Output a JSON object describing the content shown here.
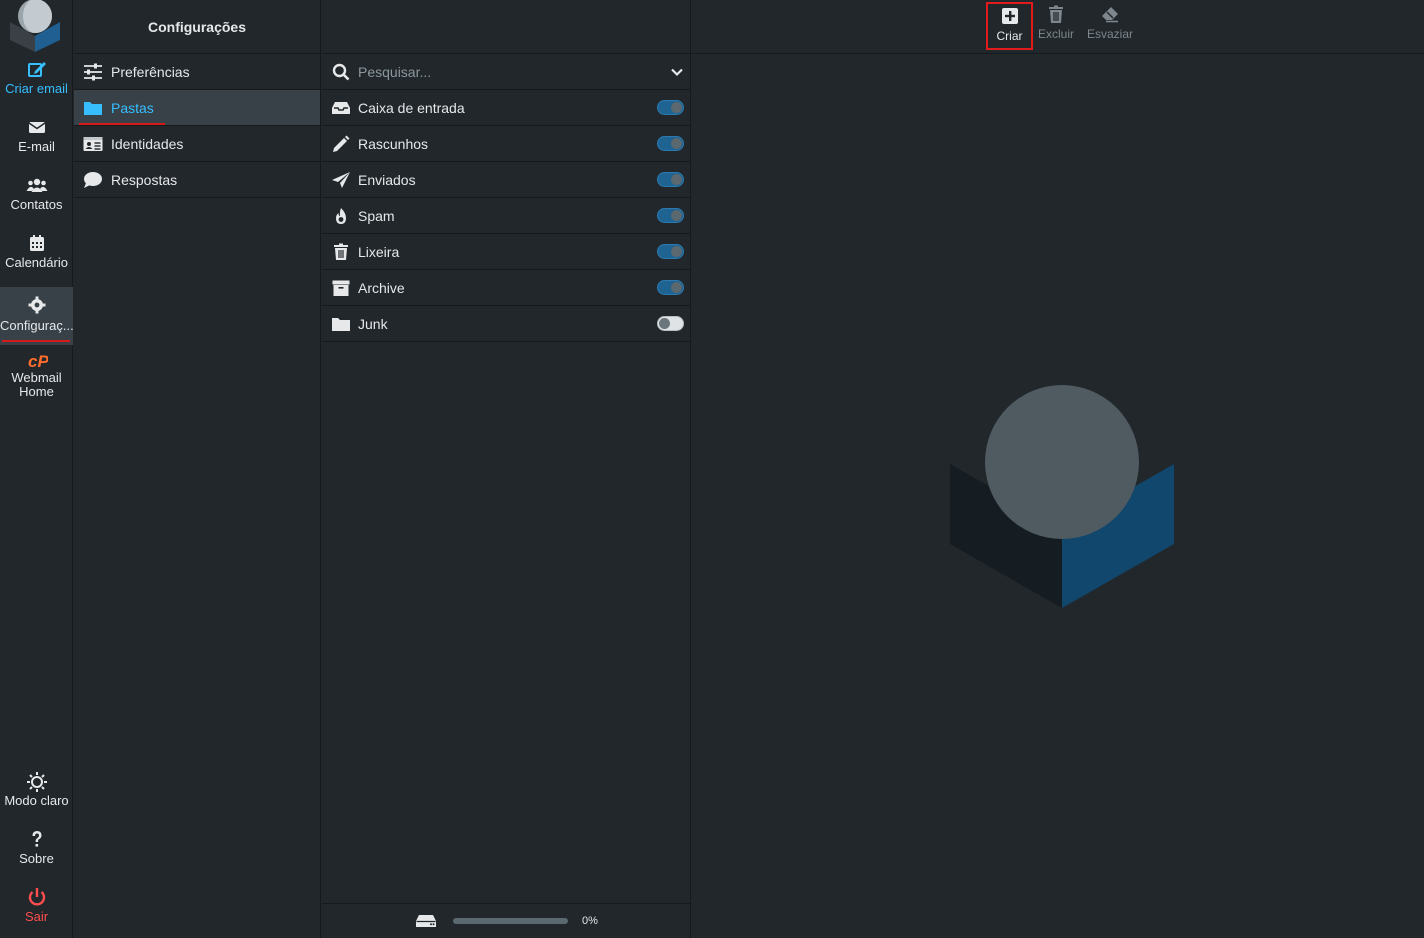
{
  "nav": {
    "items": [
      {
        "label": "Criar email",
        "icon": "compose-icon"
      },
      {
        "label": "E-mail",
        "icon": "envelope-icon"
      },
      {
        "label": "Contatos",
        "icon": "users-icon"
      },
      {
        "label": "Calendário",
        "icon": "calendar-icon"
      },
      {
        "label": "Configuraç...",
        "icon": "gear-icon"
      },
      {
        "label": "Webmail Home",
        "icon": "cpanel-icon"
      }
    ],
    "bottom": [
      {
        "label": "Modo claro",
        "icon": "sun-icon"
      },
      {
        "label": "Sobre",
        "icon": "question-icon"
      },
      {
        "label": "Sair",
        "icon": "power-icon"
      }
    ],
    "accent": "#37beff",
    "logout_color": "#ff4d4d"
  },
  "settings": {
    "title": "Configurações",
    "items": [
      {
        "label": "Preferências",
        "icon": "sliders-icon"
      },
      {
        "label": "Pastas",
        "icon": "folder-icon"
      },
      {
        "label": "Identidades",
        "icon": "id-card-icon"
      },
      {
        "label": "Respostas",
        "icon": "comment-icon"
      }
    ]
  },
  "folders": {
    "search_placeholder": "Pesquisar...",
    "items": [
      {
        "name": "Caixa de entrada",
        "icon": "inbox-icon",
        "subscribed": true
      },
      {
        "name": "Rascunhos",
        "icon": "pencil-icon",
        "subscribed": true
      },
      {
        "name": "Enviados",
        "icon": "paper-plane-icon",
        "subscribed": true
      },
      {
        "name": "Spam",
        "icon": "fire-icon",
        "subscribed": true
      },
      {
        "name": "Lixeira",
        "icon": "trash-icon",
        "subscribed": true
      },
      {
        "name": "Archive",
        "icon": "archive-icon",
        "subscribed": true
      },
      {
        "name": "Junk",
        "icon": "folder-icon",
        "subscribed": false
      }
    ],
    "quota_text": "0%",
    "quota_percent": 0
  },
  "toolbar": {
    "create_label": "Criar",
    "delete_label": "Excluir",
    "empty_label": "Esvaziar"
  }
}
